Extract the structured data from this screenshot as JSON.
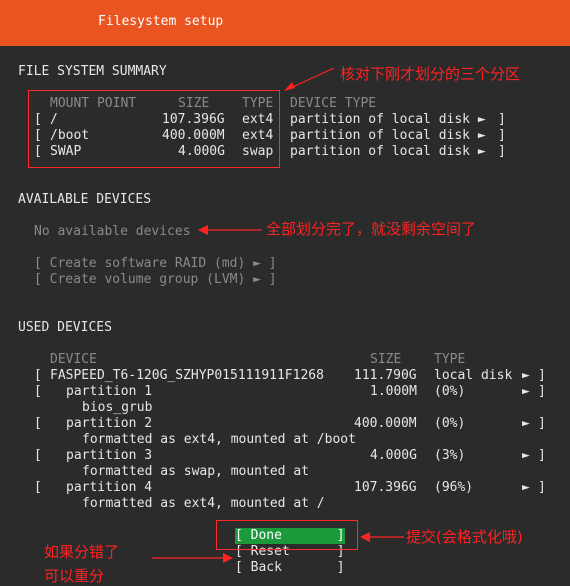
{
  "header": {
    "title": "Filesystem setup"
  },
  "fs_summary": {
    "heading": "FILE SYSTEM SUMMARY",
    "columns": [
      "MOUNT POINT",
      "SIZE",
      "TYPE",
      "DEVICE TYPE"
    ],
    "rows": [
      {
        "bracket": "[",
        "mount": "/",
        "size": "107.396G",
        "type": "ext4",
        "device_type": "partition of local disk ►",
        "end": "]"
      },
      {
        "bracket": "[",
        "mount": "/boot",
        "size": "400.000M",
        "type": "ext4",
        "device_type": "partition of local disk ►",
        "end": "]"
      },
      {
        "bracket": "[",
        "mount": "SWAP",
        "size": "4.000G",
        "type": "swap",
        "device_type": "partition of local disk ►",
        "end": "]"
      }
    ]
  },
  "available": {
    "heading": "AVAILABLE DEVICES",
    "empty_text": "No available devices",
    "actions": [
      "[ Create software RAID (md) ► ]",
      "[ Create volume group (LVM) ► ]"
    ]
  },
  "used": {
    "heading": "USED DEVICES",
    "columns": [
      "DEVICE",
      "SIZE",
      "TYPE"
    ],
    "disk": {
      "bracket": "[",
      "name": "FASPEED_T6-120G_SZHYP015111911F1268",
      "size": "111.790G",
      "type": "local disk",
      "arrow": "►",
      "end": "]"
    },
    "partitions": [
      {
        "bracket": "[",
        "label": "partition 1",
        "size": "1.000M",
        "pct": "(0%)",
        "arrow": "►",
        "end": "]",
        "detail": "bios_grub"
      },
      {
        "bracket": "[",
        "label": "partition 2",
        "size": "400.000M",
        "pct": "(0%)",
        "arrow": "►",
        "end": "]",
        "detail": "formatted as ext4, mounted at /boot"
      },
      {
        "bracket": "[",
        "label": "partition 3",
        "size": "4.000G",
        "pct": "(3%)",
        "arrow": "►",
        "end": "]",
        "detail": "formatted as swap, mounted at"
      },
      {
        "bracket": "[",
        "label": "partition 4",
        "size": "107.396G",
        "pct": "(96%)",
        "arrow": "►",
        "end": "]",
        "detail": "formatted as ext4, mounted at /"
      }
    ]
  },
  "buttons": {
    "done": "[ Done       ]",
    "reset": "[ Reset      ]",
    "back": "[ Back       ]"
  },
  "annotations": {
    "summary_note": "核对下刚才划分的三个分区",
    "available_note": "全部划分完了，就没剩余空间了",
    "done_note": "提交(会格式化哦)",
    "reset_note_1": "如果分错了",
    "reset_note_2": "可以重分"
  },
  "colors": {
    "header": "#e95420",
    "background": "#2b2b2b",
    "done_highlight": "#1a9a3a",
    "annotation": "#ff2222"
  }
}
